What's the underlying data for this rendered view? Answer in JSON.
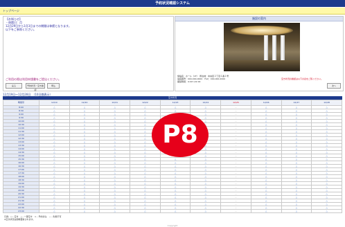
{
  "header": {
    "title": "予約状況確認システム"
  },
  "subbar": {
    "link": "トップページ"
  },
  "left_panel": {
    "notice_lines": [
      "【お知らせ】",
      "・休館日：月",
      "12月29日から1月3日までの期間は休館となります。",
      "以下をご参照ください。"
    ],
    "link": "ご利用の際は利用申請書をご提出ください。",
    "buttons": [
      "戻る",
      "予約状況・空き確認",
      "申込"
    ]
  },
  "right_panel": {
    "title": "施設の案内",
    "info_lines": [
      "施設名：ホール（1F）　所在地：中央区２丁目１番１号",
      "電話番号：000-000-0000　FAX：000-000-0000",
      "開館時間：9:00〜22:00"
    ],
    "red_note": "空き状況の確認は以下の表をご覧ください。",
    "button": "次へ"
  },
  "grid": {
    "period": "12月19日～12月28日　（10日間表示）",
    "header": "空き状況",
    "corner": "時間帯",
    "dates": [
      "12/19",
      "12/20",
      "12/21",
      "12/22",
      "12/23",
      "12/24",
      "12/25",
      "12/26",
      "12/27",
      "12/28"
    ],
    "red_dates": [
      6
    ],
    "times": [
      "8:00",
      "8:30",
      "9:00",
      "9:30",
      "10:00",
      "10:30",
      "11:00",
      "11:30",
      "12:00",
      "12:30",
      "13:00",
      "13:30",
      "14:00",
      "14:30",
      "15:00",
      "15:30",
      "16:00",
      "16:30",
      "17:00",
      "17:30",
      "18:00",
      "18:30",
      "19:00",
      "19:30",
      "20:00",
      "20:30",
      "21:00",
      "21:30",
      "22:00",
      "22:30",
      "23:00"
    ],
    "mark_available": "△",
    "mark_closed": "－",
    "closed_columns": [
      6
    ]
  },
  "footer": {
    "notes": [
      "凡例：○…空き　△…一部空き　×…予約済み　－…利用不可",
      "※空き状況は随時更新されます。"
    ],
    "copyright": "Copyright"
  },
  "badge": {
    "text": "P8"
  },
  "colors": {
    "brand": "#1d3a8c",
    "accent_red": "#e6001a",
    "subbar": "#fff9a8"
  }
}
